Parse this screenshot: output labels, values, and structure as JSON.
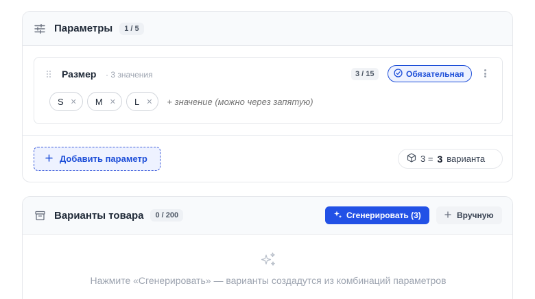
{
  "params_card": {
    "title": "Параметры",
    "count": "1 / 5",
    "add_button_label": "Добавить параметр",
    "formula": {
      "expr": "3 =",
      "result": "3",
      "suffix": "варианта"
    }
  },
  "param": {
    "name": "Размер",
    "meta": "· 3 значения",
    "count": "3 / 15",
    "required_label": "Обязательная",
    "values": [
      "S",
      "M",
      "L"
    ],
    "input_placeholder": "+ значение (можно через запятую)"
  },
  "variants_card": {
    "title": "Варианты товара",
    "count": "0 / 200",
    "generate_label": "Сгенерировать (3)",
    "manual_label": "Вручную",
    "empty_text": "Нажмите «Сгенерировать» — варианты создадутся из комбинаций параметров"
  },
  "colors": {
    "accent": "#2251e6",
    "accent_text": "#1d4ed8",
    "muted": "#9ca3af",
    "border": "#e5e7eb"
  },
  "icons": [
    "sliders-icon",
    "drag-handle-icon",
    "check-circle-icon",
    "kebab-icon",
    "close-icon",
    "plus-icon",
    "cube-icon",
    "archive-icon",
    "sparkles-icon"
  ]
}
